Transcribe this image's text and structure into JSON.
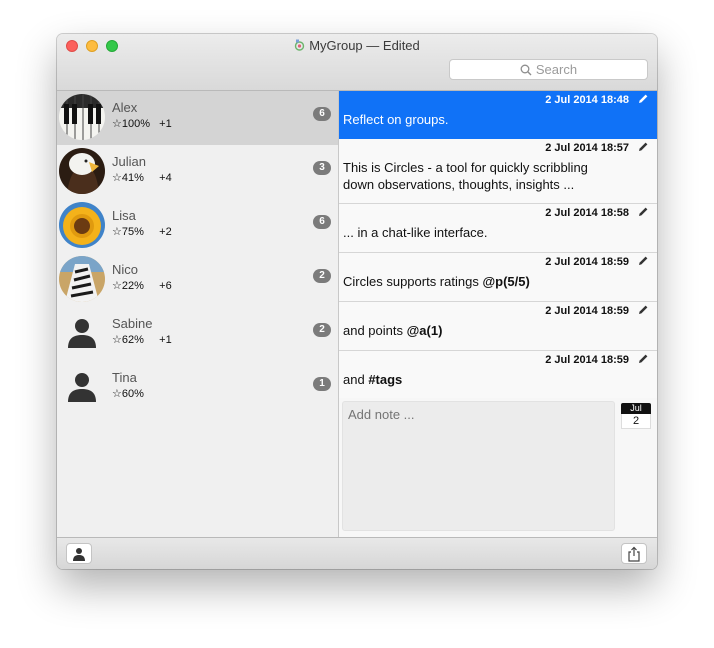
{
  "window": {
    "title": "MyGroup",
    "title_suffix": "— Edited",
    "search": {
      "placeholder": "Search"
    }
  },
  "contacts": [
    {
      "name": "Alex",
      "rating": "☆100%",
      "points": "+1",
      "count": "6",
      "avatar": "piano"
    },
    {
      "name": "Julian",
      "rating": "☆41%",
      "points": "+4",
      "count": "3",
      "avatar": "eagle"
    },
    {
      "name": "Lisa",
      "rating": "☆75%",
      "points": "+2",
      "count": "6",
      "avatar": "sunflower"
    },
    {
      "name": "Nico",
      "rating": "☆22%",
      "points": "+6",
      "count": "2",
      "avatar": "zebra"
    },
    {
      "name": "Sabine",
      "rating": "☆62%",
      "points": "+1",
      "count": "2",
      "avatar": "person"
    },
    {
      "name": "Tina",
      "rating": "☆60%",
      "points": "",
      "count": "1",
      "avatar": "person"
    }
  ],
  "messages": [
    {
      "time": "2 Jul 2014 18:48",
      "text": "Reflect on groups.",
      "selected": true
    },
    {
      "time": "2 Jul 2014 18:57",
      "text": "This is Circles - a tool for quickly scribbling down observations, thoughts, insights ..."
    },
    {
      "time": "2 Jul 2014 18:58",
      "text": "... in a chat-like interface."
    },
    {
      "time": "2 Jul 2014 18:59",
      "text_plain": "Circles supports ratings ",
      "text_bold": "@p(5/5)"
    },
    {
      "time": "2 Jul 2014 18:59",
      "text_plain": "and points ",
      "text_bold": "@a(1)"
    },
    {
      "time": "2 Jul 2014 18:59",
      "text_plain": "and ",
      "text_bold": "#tags"
    }
  ],
  "note": {
    "placeholder": "Add note ..."
  },
  "date_icon": {
    "month": "Jul",
    "day": "2"
  },
  "icons": {
    "edit": "pencil-icon",
    "add_person": "person-icon",
    "share": "share-icon",
    "search": "search-icon"
  },
  "colors": {
    "selection_blue": "#1072f7",
    "badge_gray": "#7b7b7b"
  }
}
